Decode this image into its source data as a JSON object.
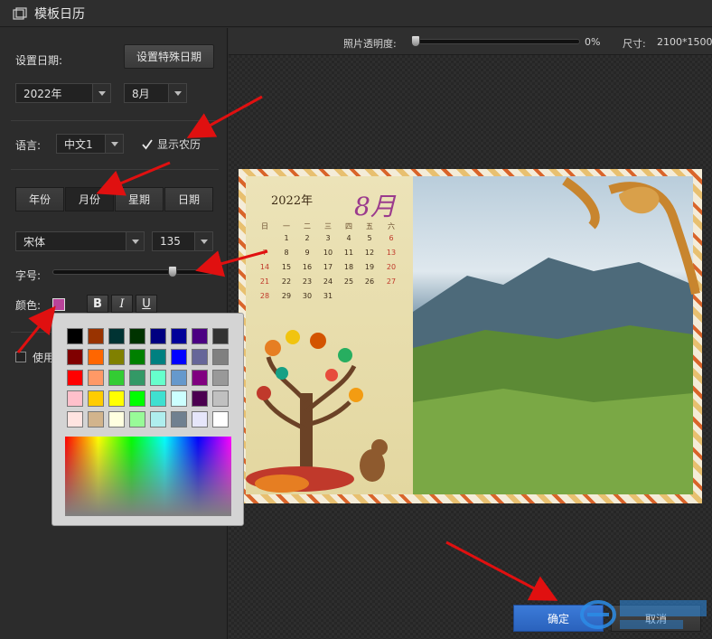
{
  "window": {
    "title": "模板日历"
  },
  "left": {
    "set_date_label": "设置日期:",
    "special_date_button": "设置特殊日期",
    "year_value": "2022年",
    "month_value": "8月",
    "language_label": "语言:",
    "language_value": "中文1",
    "show_lunar_label": "显示农历",
    "show_lunar_checked": true,
    "tabs": [
      "年份",
      "月份",
      "星期",
      "日期"
    ],
    "active_tab": "月份",
    "font_value": "宋体",
    "font_size_value": "135",
    "size_label": "字号:",
    "color_label": "颜色:",
    "bold_label": "B",
    "italic_label": "I",
    "underline_label": "U",
    "use_label": "使用",
    "selected_color": "#b9439a",
    "font_size_slider_fraction": 0.75
  },
  "palette": {
    "rows": [
      [
        "#000000",
        "#993300",
        "#003333",
        "#003300",
        "#000080",
        "#000099",
        "#4b0082",
        "#333333"
      ],
      [
        "#800000",
        "#ff6600",
        "#808000",
        "#008000",
        "#008080",
        "#0000ff",
        "#666699",
        "#808080"
      ],
      [
        "#ff0000",
        "#ff9966",
        "#33cc33",
        "#339966",
        "#66ffcc",
        "#6699cc",
        "#800080",
        "#999999"
      ],
      [
        "#ffc0cb",
        "#ffcc00",
        "#ffff00",
        "#00ff00",
        "#40e0d0",
        "#ccffff",
        "#4b0050",
        "#c0c0c0"
      ],
      [
        "#ffe4e1",
        "#d2b48c",
        "#ffffe0",
        "#98fb98",
        "#afeeee",
        "#708090",
        "#e6e6fa",
        "#ffffff"
      ]
    ]
  },
  "preview": {
    "opacity_label": "照片透明度:",
    "opacity_value": "0%",
    "opacity_fraction": 0.0,
    "size_label": "尺寸:",
    "size_value": "2100*1500"
  },
  "calendar": {
    "year": "2022年",
    "month": "8月",
    "weekday_headers": [
      "日",
      "一",
      "二",
      "三",
      "四",
      "五",
      "六"
    ],
    "weeks": [
      [
        "",
        "1",
        "2",
        "3",
        "4",
        "5",
        "6"
      ],
      [
        "7",
        "8",
        "9",
        "10",
        "11",
        "12",
        "13"
      ],
      [
        "14",
        "15",
        "16",
        "17",
        "18",
        "19",
        "20"
      ],
      [
        "21",
        "22",
        "23",
        "24",
        "25",
        "26",
        "27"
      ],
      [
        "28",
        "29",
        "30",
        "31",
        "",
        "",
        ""
      ]
    ]
  },
  "footer": {
    "confirm_label": "确定",
    "cancel_label": "取消"
  },
  "colors": {
    "accent": "#2a62bd",
    "annotation_arrow": "#e01010",
    "month_title": "#9b3b8d"
  }
}
